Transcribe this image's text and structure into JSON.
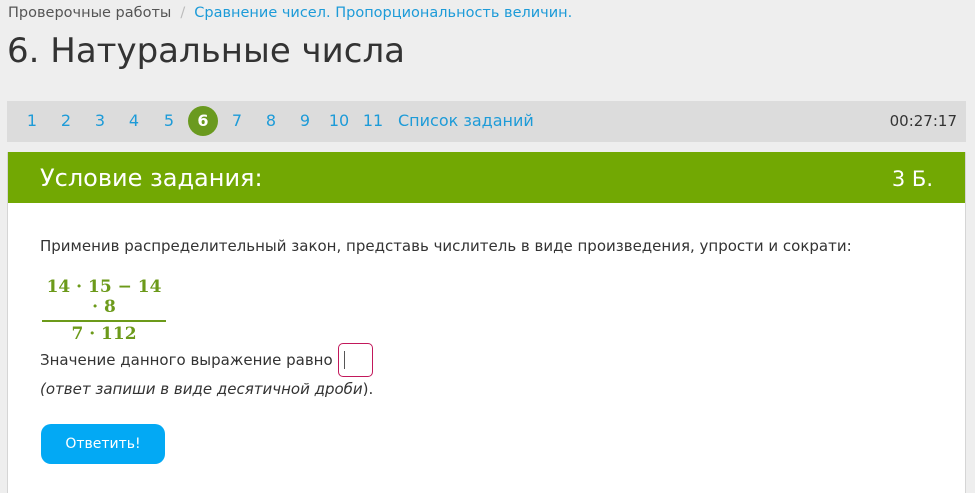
{
  "breadcrumb": {
    "root": "Проверочные работы",
    "separator": "/",
    "current": "Сравнение чисел. Пропорциональность величин."
  },
  "page_title": "6. Натуральные числа",
  "task_nav": {
    "items": [
      "1",
      "2",
      "3",
      "4",
      "5",
      "6",
      "7",
      "8",
      "9",
      "10",
      "11"
    ],
    "current": "6",
    "list_link": "Список заданий",
    "timer": "00:27:17"
  },
  "card": {
    "title": "Условие задания:",
    "points": "3 Б.",
    "instruction": "Применив распределительный закон, представь числитель в виде произведения, упрости и сократи:",
    "fraction": {
      "numerator": "14 · 15 − 14 · 8",
      "denominator": "7 · 112"
    },
    "answer_label": "Значение данного выражение равно",
    "answer_value": "",
    "hint_italic": "(ответ запиши в виде десятичной дроби",
    "hint_tail": ").",
    "submit_label": "Ответить!"
  },
  "colors": {
    "accent_green": "#72a803",
    "link_blue": "#1d9bd8",
    "button_blue": "#03a9f4",
    "current_task": "#6a9a1f",
    "input_border": "#c2185b"
  }
}
